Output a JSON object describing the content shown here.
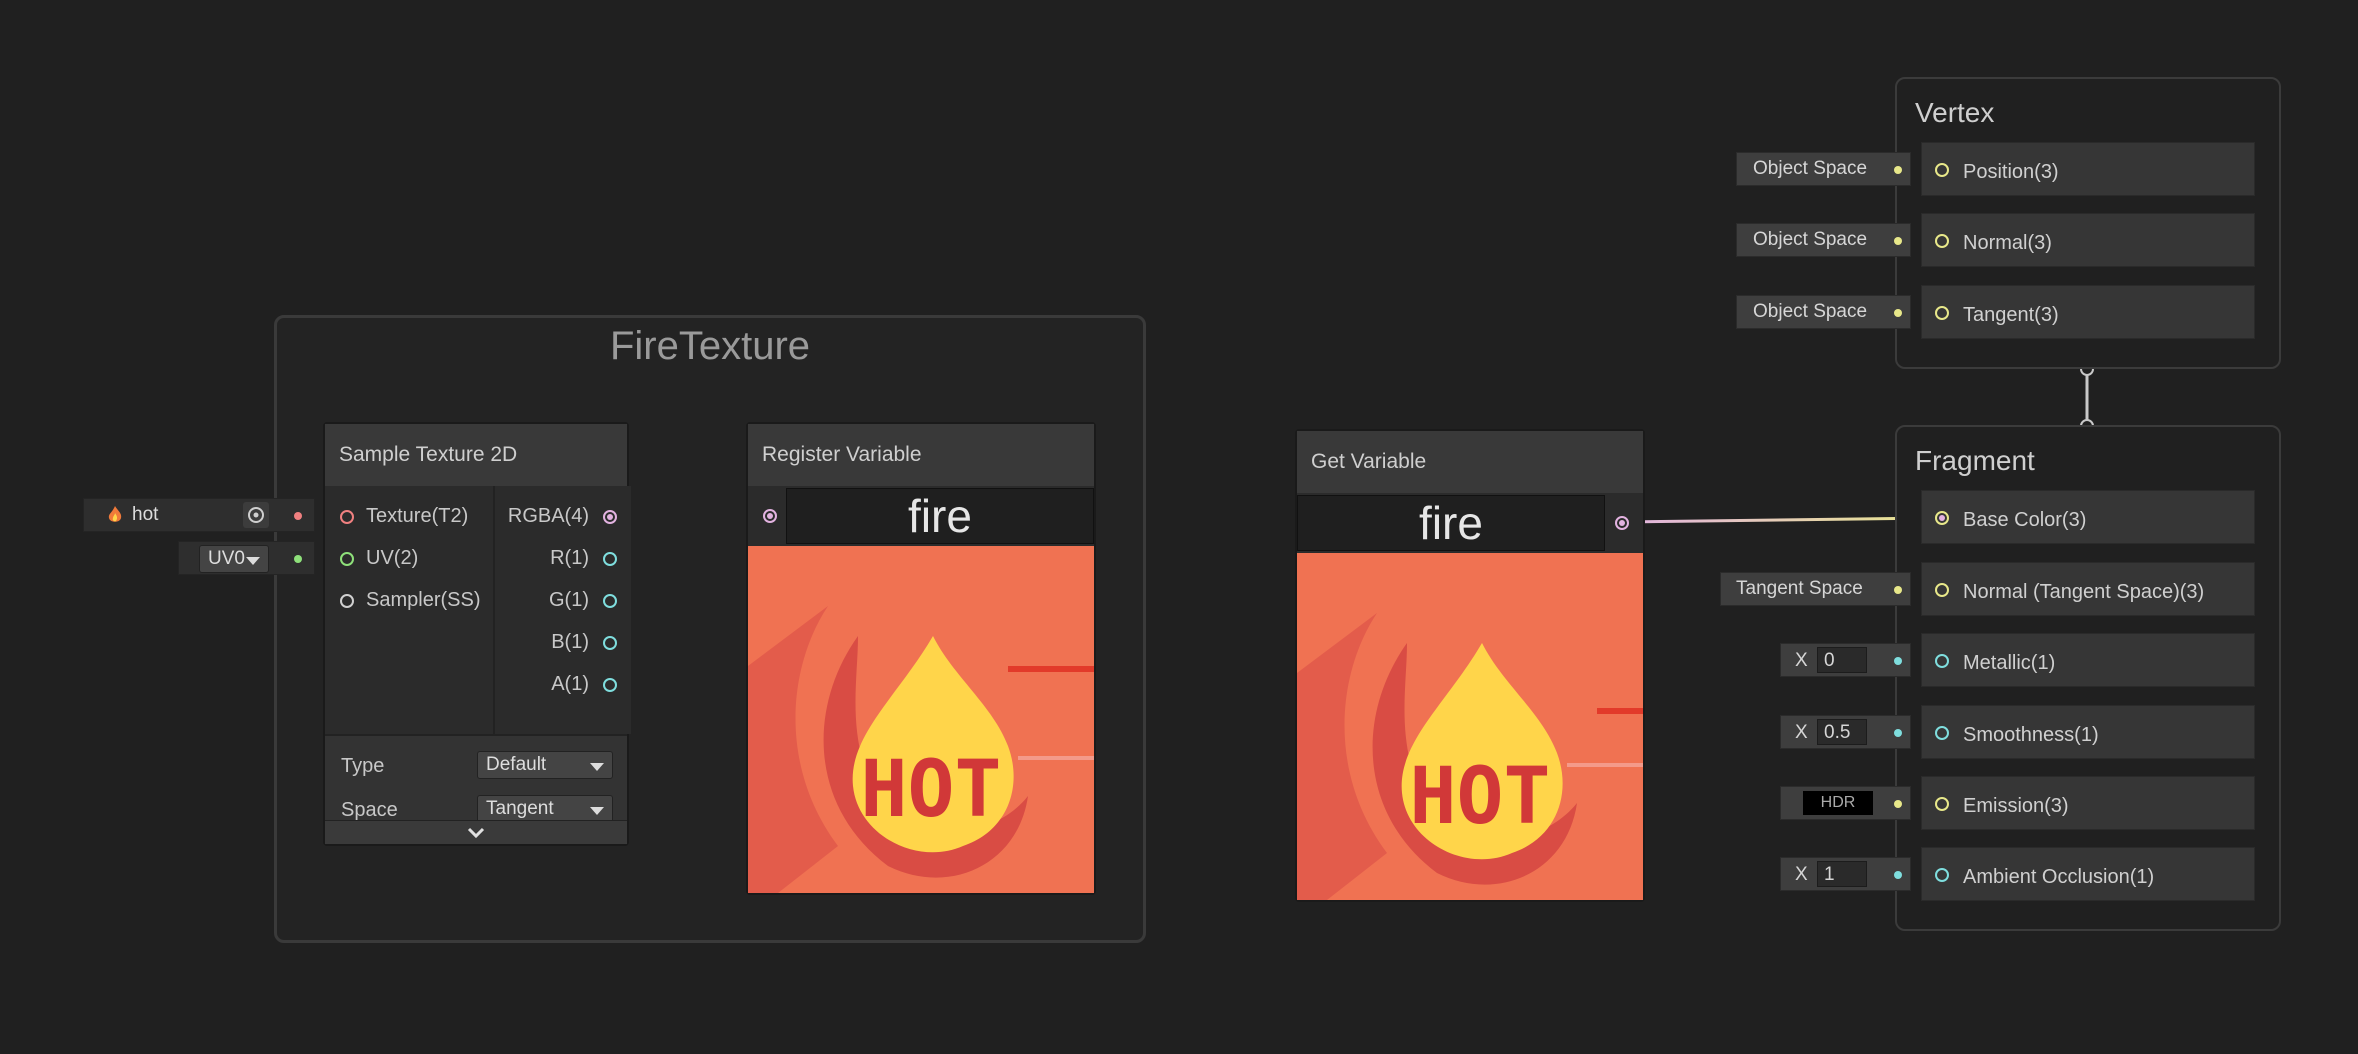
{
  "group": {
    "title": "FireTexture"
  },
  "sample_texture": {
    "title": "Sample Texture 2D",
    "inputs": [
      "Texture(T2)",
      "UV(2)",
      "Sampler(SS)"
    ],
    "outputs": [
      "RGBA(4)",
      "R(1)",
      "G(1)",
      "B(1)",
      "A(1)"
    ],
    "type_label": "Type",
    "type_value": "Default",
    "space_label": "Space",
    "space_value": "Tangent",
    "texture_inlet": "hot",
    "uv_inlet": "UV0"
  },
  "register_variable": {
    "title": "Register Variable",
    "value": "fire"
  },
  "get_variable": {
    "title": "Get Variable",
    "value": "fire"
  },
  "preview_text": "HOT",
  "vertex": {
    "title": "Vertex",
    "slots": [
      {
        "label": "Position(3)",
        "inlet": "Object Space"
      },
      {
        "label": "Normal(3)",
        "inlet": "Object Space"
      },
      {
        "label": "Tangent(3)",
        "inlet": "Object Space"
      }
    ]
  },
  "fragment": {
    "title": "Fragment",
    "slots": [
      {
        "label": "Base Color(3)"
      },
      {
        "label": "Normal (Tangent Space)(3)",
        "inlet": "Tangent Space"
      },
      {
        "label": "Metallic(1)",
        "axis": "X",
        "value": "0"
      },
      {
        "label": "Smoothness(1)",
        "axis": "X",
        "value": "0.5"
      },
      {
        "label": "Emission(3)",
        "inlet": "HDR"
      },
      {
        "label": "Ambient Occlusion(1)",
        "axis": "X",
        "value": "1"
      }
    ]
  },
  "colors": {
    "background": "#202020",
    "wire_pink": "#e2b2e0",
    "wire_yellow": "#e8e88a",
    "wire_green": "#8ee07a",
    "wire_cyan": "#7fdede",
    "wire_red": "#f08080",
    "preview_bg": "#f07252"
  },
  "icons": [
    "flame-icon",
    "target-icon",
    "chevron-down-icon",
    "caret-down-icon"
  ]
}
